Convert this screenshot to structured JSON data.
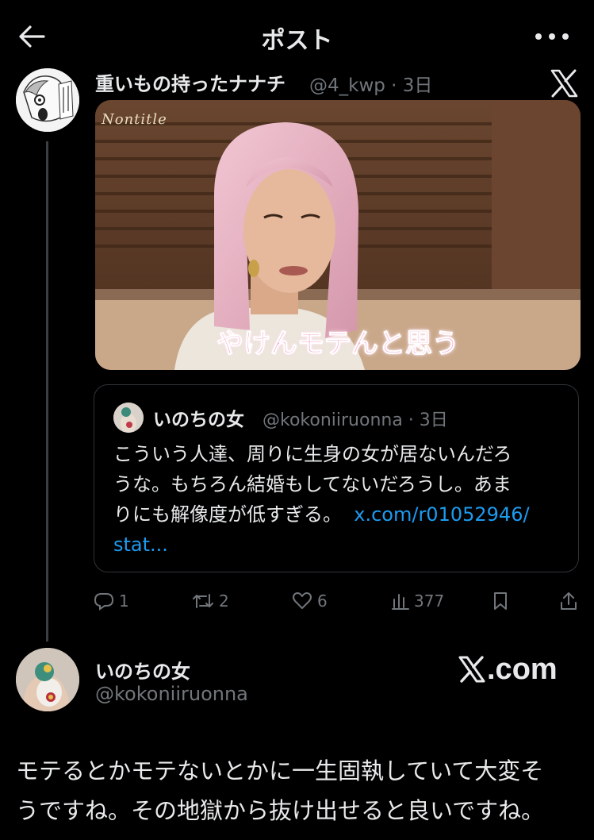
{
  "header": {
    "title": "ポスト",
    "back_icon": "arrow-left-icon",
    "more_icon": "more-horizontal-icon"
  },
  "post": {
    "author_name": "重いもの持ったナナチ",
    "author_handle": "@4_kwp · 3日",
    "media": {
      "watermark": "Nontitle",
      "caption": "やけんモテんと思う"
    },
    "quote": {
      "author_name": "いのちの女",
      "author_handle": "@kokoniiruonna · 3日",
      "text_line1": "こういう人達、周りに生身の女が居ないんだろ",
      "text_line2": "うな。もちろん結婚もしてないだろうし。あま",
      "text_line3": "りにも解像度が低すぎる。",
      "link_part1": "x.com/r01052946/",
      "link_part2": "stat..."
    },
    "actions": {
      "reply_count": "1",
      "repost_count": "2",
      "like_count": "6",
      "view_count": "377"
    }
  },
  "reply": {
    "author_name": "いのちの女",
    "author_handle": "@kokoniiruonna",
    "brand": ".com",
    "text_line1": "モテるとかモテないとかに一生固執していて大変そ",
    "text_line2": "うですね。その地獄から抜け出せると良いですね。"
  },
  "colors": {
    "background": "#000000",
    "text": "#e7e9ea",
    "muted": "#71767b",
    "link": "#1d9bf0",
    "border": "#2f3336"
  }
}
